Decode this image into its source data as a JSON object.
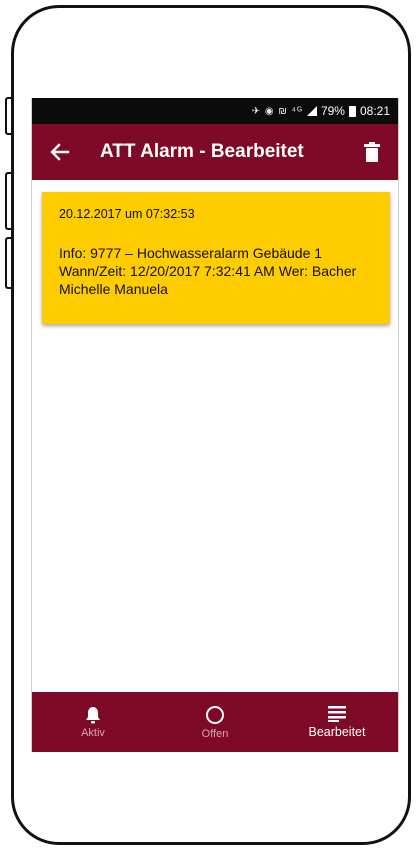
{
  "status_bar": {
    "network_icons": "✈ ◉ ₪ ⁴ᴳ",
    "battery_percent": "79%",
    "time": "08:21"
  },
  "app_bar": {
    "back_icon": "arrow-left-icon",
    "title": "ATT Alarm - Bearbeitet",
    "delete_icon": "trash-icon"
  },
  "alarm": {
    "date": "20.12.2017 um 07:32:53",
    "info": "Info: 9777 – Hochwasseralarm Gebäude 1 Wann/Zeit: 12/20/2017 7:32:41 AM Wer: Bacher Michelle Manuela",
    "background": "#ffcc00"
  },
  "bottom_nav": {
    "items": [
      {
        "label": "Aktiv",
        "icon": "bell-icon",
        "active": false
      },
      {
        "label": "Offen",
        "icon": "circle-icon",
        "active": false
      },
      {
        "label": "Bearbeitet",
        "icon": "list-icon",
        "active": true
      }
    ]
  },
  "colors": {
    "primary": "#7e0a27",
    "card": "#ffcc00",
    "status_bar": "#0b0b0b"
  }
}
